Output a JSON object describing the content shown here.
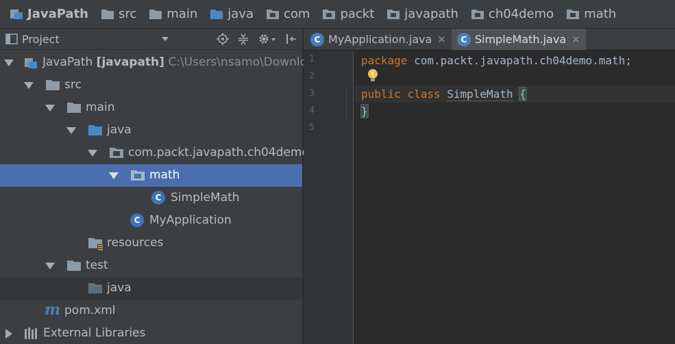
{
  "breadcrumb": {
    "items": [
      "JavaPath",
      "src",
      "main",
      "java",
      "com",
      "packt",
      "javapath",
      "ch04demo",
      "math"
    ]
  },
  "project_panel": {
    "title": "Project"
  },
  "tree": {
    "root_name": "JavaPath",
    "root_module": "[javapath]",
    "root_path": "C:\\Users\\nsamo\\Download",
    "src": "src",
    "main": "main",
    "java": "java",
    "package": "com.packt.javapath.ch04demo",
    "math": "math",
    "simple_math": "SimpleMath",
    "my_application": "MyApplication",
    "resources": "resources",
    "test": "test",
    "test_java": "java",
    "pom": "pom.xml",
    "external": "External Libraries"
  },
  "tabs": [
    {
      "label": "MyApplication.java",
      "badge": "C"
    },
    {
      "label": "SimpleMath.java",
      "badge": "C"
    }
  ],
  "editor": {
    "line_numbers": [
      "1",
      "2",
      "3",
      "4",
      "5"
    ],
    "line1_kw": "package",
    "line1_rest": " com.packt.javapath.ch04demo.math;",
    "line3_kw1": "public",
    "line3_kw2": "class",
    "line3_name": "SimpleMath",
    "line3_brace": "{",
    "line4_brace": "}"
  },
  "badges": {
    "class": "C",
    "maven": "m"
  },
  "colors": {
    "selection": "#4b6eaf",
    "keyword": "#cc7832",
    "folder_blue": "#4a88c7",
    "panel_bg": "#3c3f41",
    "editor_bg": "#2b2b2b"
  }
}
